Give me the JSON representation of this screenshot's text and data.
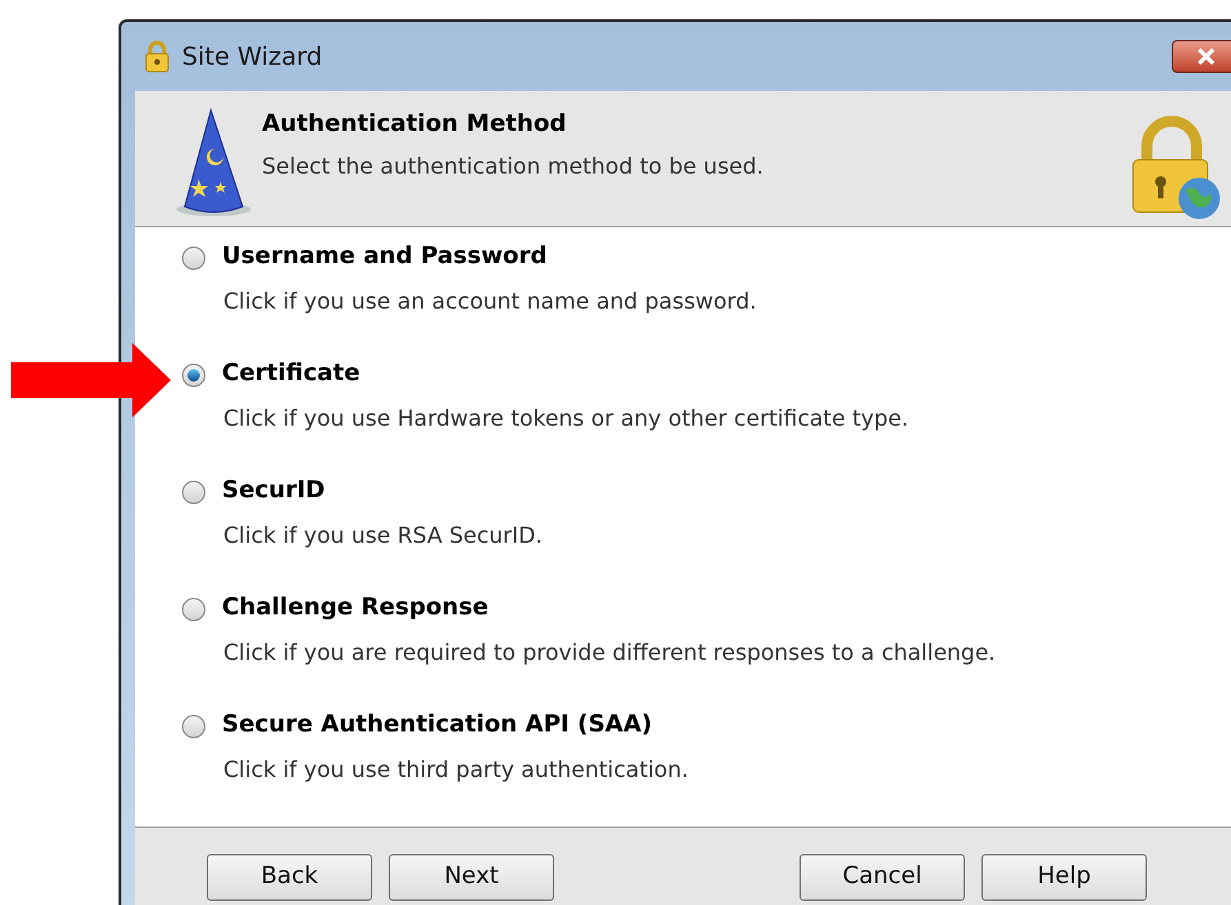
{
  "window": {
    "title": "Site Wizard"
  },
  "header": {
    "title": "Authentication Method",
    "subtitle": "Select the authentication method to be used."
  },
  "options": [
    {
      "label": "Username and Password",
      "description": "Click if you use an account name and password.",
      "selected": false
    },
    {
      "label": "Certificate",
      "description": "Click if you use Hardware tokens or any other certificate type.",
      "selected": true
    },
    {
      "label": "SecurID",
      "description": "Click if you use RSA SecurID.",
      "selected": false
    },
    {
      "label": "Challenge Response",
      "description": "Click if you are required to provide different responses to a challenge.",
      "selected": false
    },
    {
      "label": "Secure Authentication API (SAA)",
      "description": "Click if you use third party authentication.",
      "selected": false
    }
  ],
  "buttons_left": [
    "Back",
    "Next"
  ],
  "buttons_right": [
    "Cancel",
    "Help"
  ]
}
